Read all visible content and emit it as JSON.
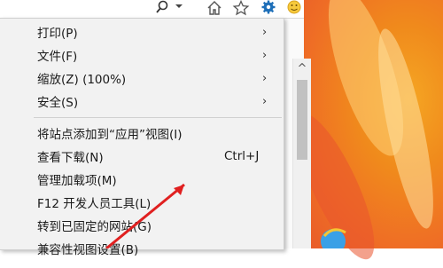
{
  "menu": {
    "items": [
      {
        "label": "打印(P)",
        "submenu": true
      },
      {
        "label": "文件(F)",
        "submenu": true
      },
      {
        "label": "缩放(Z) (100%)",
        "submenu": true
      },
      {
        "label": "安全(S)",
        "submenu": true
      },
      {
        "label": "将站点添加到“应用”视图(I)"
      },
      {
        "label": "查看下载(N)",
        "shortcut": "Ctrl+J"
      },
      {
        "label": "管理加载项(M)"
      },
      {
        "label": "F12 开发人员工具(L)"
      },
      {
        "label": "转到已固定的网站(G)"
      },
      {
        "label": "兼容性视图设置(B)"
      }
    ],
    "submenu_arrow": "›"
  },
  "toolbar": {
    "icons": [
      "search-icon",
      "dropdown-icon",
      "home-icon",
      "favorites-icon",
      "settings-icon",
      "smiley-icon"
    ]
  },
  "scrollbar": {
    "up_arrow": "^"
  },
  "colors": {
    "accent_red": "#e02020",
    "wallpaper": "#f08a1c",
    "gear_blue": "#1e6fb8"
  }
}
